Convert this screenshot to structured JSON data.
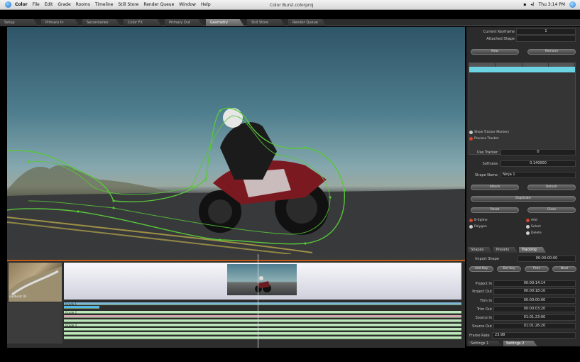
{
  "menubar": {
    "app_name": "Color",
    "items": [
      "File",
      "Edit",
      "Grade",
      "Rooms",
      "Timeline",
      "Still Store",
      "Render Queue",
      "Window",
      "Help"
    ],
    "document_title": "Color Burst.colorproj",
    "clock": "Thu 3:14 PM"
  },
  "rooms": [
    "Setup",
    "Primary In",
    "Secondaries",
    "Color FX",
    "Primary Out",
    "Geometry",
    "Still Store",
    "Render Queue"
  ],
  "active_room": "Geometry",
  "tracking": {
    "current_keyframe_label": "Current Keyframe",
    "current_keyframe_value": "1",
    "attached_shape_label": "Attached Shape",
    "attached_shape_value": "",
    "button_new": "New",
    "button_remove": "Remove",
    "checkbox_1": "Show Tracker Markers",
    "checkbox_2": "Process Tracker",
    "use_tracker_label": "Use Tracker",
    "use_tracker_value": "0",
    "softness_label": "Softness",
    "softness_value": "0.140000",
    "shape_name_label": "Shape Name",
    "shape_name_value": "Ninja 1",
    "shape_buttons": [
      "Attach",
      "Detach",
      "Duplicate",
      "Reset",
      "Close"
    ],
    "radio_left": [
      "B-Spline",
      "Polygon"
    ],
    "radio_right": [
      "Add",
      "Select",
      "Delete"
    ]
  },
  "panel_tabs": [
    "Shapes",
    "Presets",
    "Tracking"
  ],
  "shapes": {
    "import_label": "Import Shape",
    "import_value": "00:00:00:00",
    "mini_buttons": [
      "Add Key",
      "Del Key",
      "Prev",
      "Next"
    ],
    "fields": [
      {
        "label": "Project In",
        "value": "00:00:14:14"
      },
      {
        "label": "Project Out",
        "value": "00:00:18:10"
      },
      {
        "label": "Trim In",
        "value": "00:00:00:00"
      },
      {
        "label": "Trim Out",
        "value": "00:00:03:20"
      },
      {
        "label": "Source In",
        "value": "01:01:23:00"
      },
      {
        "label": "Source Out",
        "value": "01:01:26:20"
      }
    ],
    "frame_rate_label": "Frame Rate",
    "frame_rate_value": "23.98",
    "bottom_tabs": [
      "Settings 1",
      "Settings 2"
    ]
  },
  "timeline": {
    "thumb_label": "sailboat 01",
    "track_labels": [
      "Grade 1",
      "Grade 2",
      "Grade 3"
    ]
  }
}
